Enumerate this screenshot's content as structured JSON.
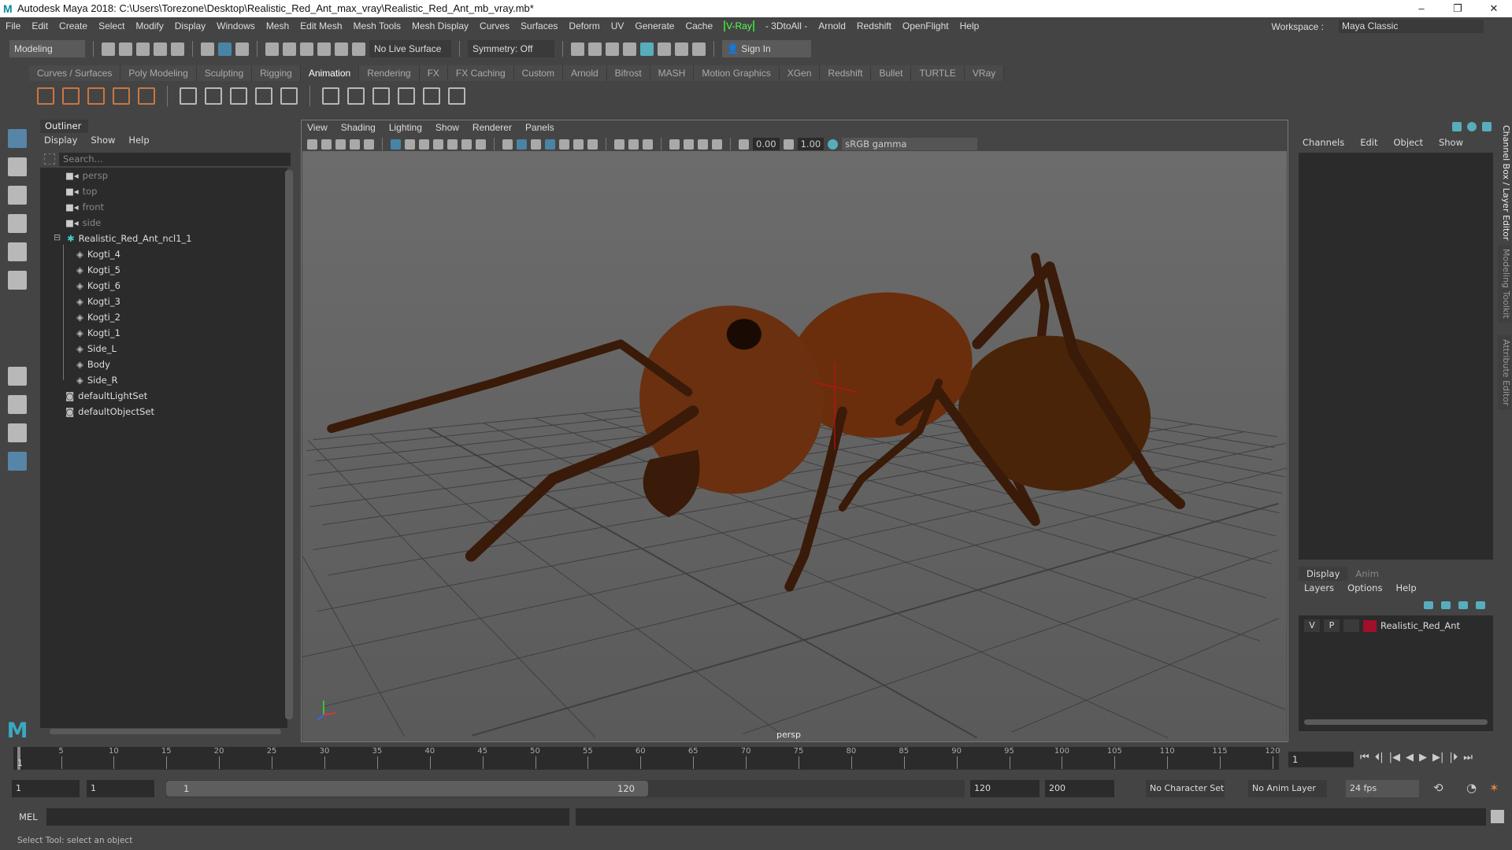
{
  "window": {
    "title": "Autodesk Maya 2018: C:\\Users\\Torezone\\Desktop\\Realistic_Red_Ant_max_vray\\Realistic_Red_Ant_mb_vray.mb*",
    "logo": "M",
    "min": "–",
    "max": "❐",
    "close": "✕"
  },
  "menubar": {
    "items": [
      "File",
      "Edit",
      "Create",
      "Select",
      "Modify",
      "Display",
      "Windows",
      "Mesh",
      "Edit Mesh",
      "Mesh Tools",
      "Mesh Display",
      "Curves",
      "Surfaces",
      "Deform",
      "UV",
      "Generate",
      "Cache",
      "V-Ray",
      "- 3DtoAll -",
      "Arnold",
      "Redshift",
      "OpenFlight",
      "Help"
    ],
    "workspace_label": "Workspace :",
    "workspace_value": "Maya Classic"
  },
  "statusline": {
    "mode": "Modeling",
    "live_surface": "No Live Surface",
    "symmetry": "Symmetry: Off",
    "sign_in": "Sign In"
  },
  "shelf": {
    "tabs": [
      "Curves / Surfaces",
      "Poly Modeling",
      "Sculpting",
      "Rigging",
      "Animation",
      "Rendering",
      "FX",
      "FX Caching",
      "Custom",
      "Arnold",
      "Bifrost",
      "MASH",
      "Motion Graphics",
      "XGen",
      "Redshift",
      "Bullet",
      "TURTLE",
      "VRay"
    ],
    "active_tab": "Animation"
  },
  "outliner": {
    "title": "Outliner",
    "menu": [
      "Display",
      "Show",
      "Help"
    ],
    "search_placeholder": "Search...",
    "cameras": [
      "persp",
      "top",
      "front",
      "side"
    ],
    "group": "Realistic_Red_Ant_ncl1_1",
    "children": [
      "Kogti_4",
      "Kogti_5",
      "Kogti_6",
      "Kogti_3",
      "Kogti_2",
      "Kogti_1",
      "Side_L",
      "Body",
      "Side_R"
    ],
    "sets": [
      "defaultLightSet",
      "defaultObjectSet"
    ]
  },
  "viewport": {
    "menu": [
      "View",
      "Shading",
      "Lighting",
      "Show",
      "Renderer",
      "Panels"
    ],
    "near": "0.00",
    "gamma_value": "1.00",
    "color_space": "sRGB gamma",
    "camera_label": "persp"
  },
  "channelbox": {
    "menu": [
      "Channels",
      "Edit",
      "Object",
      "Show"
    ]
  },
  "layer_editor": {
    "tabs": [
      "Display",
      "Anim"
    ],
    "menu": [
      "Layers",
      "Options",
      "Help"
    ],
    "layer": {
      "v": "V",
      "p": "P",
      "name": "Realistic_Red_Ant",
      "color": "#a0102a"
    }
  },
  "side_tabs": [
    "Channel Box / Layer Editor",
    "Modeling Toolkit",
    "Attribute Editor"
  ],
  "timeline": {
    "ticks": [
      5,
      10,
      15,
      20,
      25,
      30,
      35,
      40,
      45,
      50,
      55,
      60,
      65,
      70,
      75,
      80,
      85,
      90,
      95,
      100,
      105,
      110,
      115,
      120
    ],
    "start": 1,
    "end": 120,
    "current_frame": "1",
    "current_marker": "1"
  },
  "range": {
    "start": "1",
    "playback_start": "1",
    "slider_start": "1",
    "slider_end": "120",
    "playback_end": "120",
    "end": "200",
    "character_set": "No Character Set",
    "anim_layer": "No Anim Layer",
    "fps": "24 fps"
  },
  "playback": [
    "⏮",
    "⏴|",
    "|◀",
    "◀",
    "▶",
    "▶|",
    "|⏵",
    "⏭"
  ],
  "mel": {
    "label": "MEL"
  },
  "help_line": "Select Tool: select an object",
  "colors": {
    "ant": "#6a3010",
    "accent": "#5a90b8"
  }
}
